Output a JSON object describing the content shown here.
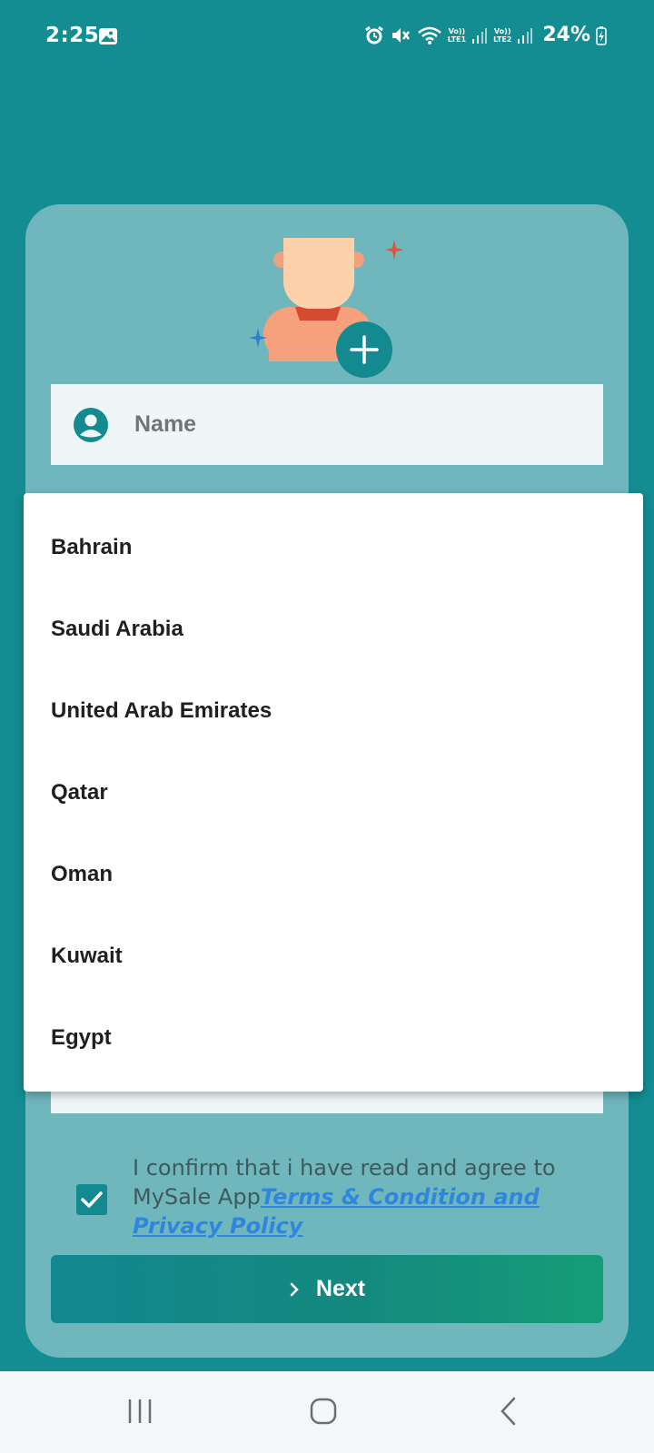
{
  "status_bar": {
    "time": "2:25",
    "lte1": "LTE1",
    "lte2": "LTE2",
    "volte": "Vo))",
    "battery": "24%",
    "icons": [
      "gallery-icon",
      "alarm-icon",
      "mute-icon",
      "wifi-icon",
      "signal-icon",
      "battery-charging-icon"
    ]
  },
  "form": {
    "name_placeholder": "Name",
    "add_photo_icon": "plus-icon",
    "user_icon": "user-icon"
  },
  "dropdown": {
    "options": [
      "Bahrain",
      "Saudi Arabia",
      "United Arab Emirates",
      "Qatar",
      "Oman",
      "Kuwait",
      "Egypt"
    ]
  },
  "agreement": {
    "checked": true,
    "text": "I confirm that i have read and agree to MySale App",
    "link": "Terms & Condition and Privacy Policy"
  },
  "next_button": {
    "label": "Next"
  },
  "colors": {
    "background": "#138d92",
    "card": "#6fb7bd",
    "accent": "#128a8f",
    "link": "#2f86e0",
    "button_gradient_end": "#159d77"
  }
}
